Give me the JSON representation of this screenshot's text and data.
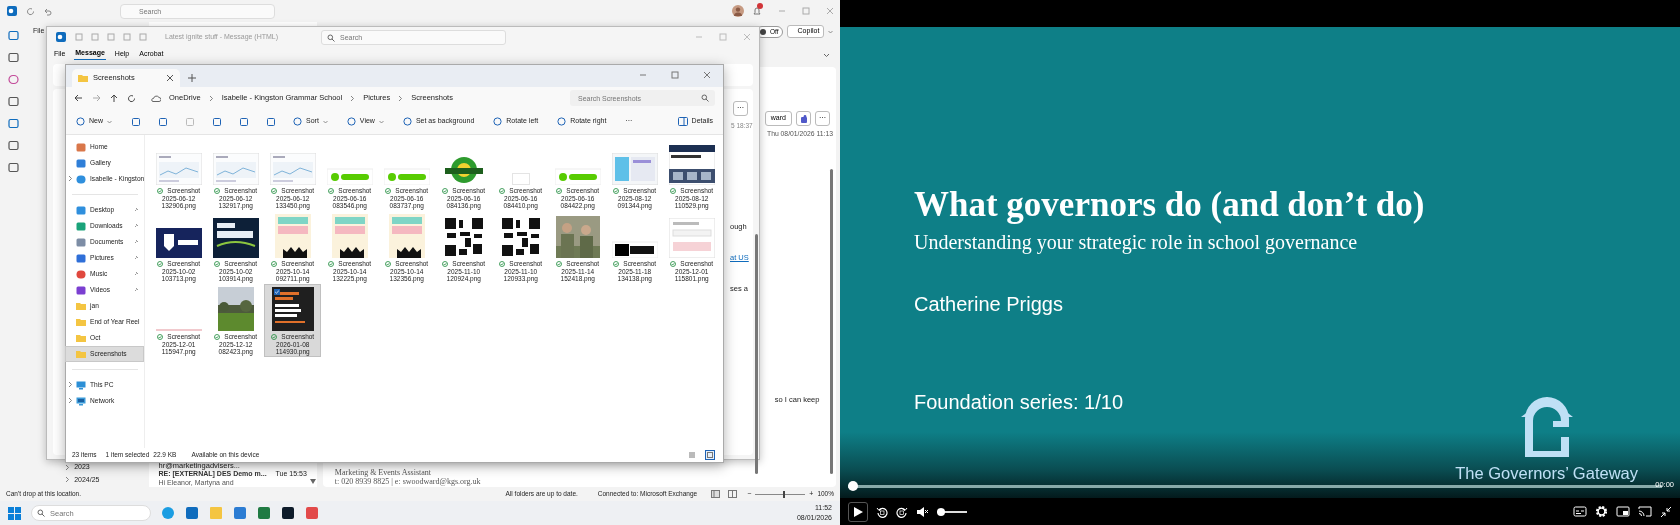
{
  "outlook": {
    "search_placeholder": "Search",
    "menu_file": "File",
    "copilot_toggle": {
      "label": "Off",
      "on": false
    },
    "copilot": "Copilot",
    "folders": [
      "2023",
      "2024/25"
    ],
    "message_list": {
      "sender": "hr@marketingadvisers...",
      "subject": "RE: [EXTERNAL] DES Demo m...",
      "time": "Tue 15:53",
      "preview": "Hi Eleanor, Martyna and"
    },
    "reading": {
      "forward_fragment": "ward",
      "more_label": "···",
      "date": "Thu 08/01/2026 11:13",
      "text_fragment": "so I can keep",
      "signature": [
        "Marketing & Events Assistant",
        "t: 020 8939 8825 | e: swoodward@kgs.org.uk"
      ]
    },
    "status_bar": {
      "message": "Can't drop at this location.",
      "sync": "All folders are up to date.",
      "connection": "Connected to: Microsoft Exchange",
      "zoom_out": "−",
      "zoom_in": "+",
      "zoom": "100%",
      "level": 0.55
    }
  },
  "message_window": {
    "title": "Latest ignite stuff - Message (HTML)",
    "search_placeholder": "Search",
    "tabs": [
      {
        "label": "File",
        "selected": false
      },
      {
        "label": "Message",
        "selected": true
      },
      {
        "label": "Help",
        "selected": false
      },
      {
        "label": "Acrobat",
        "selected": false
      }
    ],
    "more_label": "···",
    "time_fragment": "5 18:37",
    "text_fragments": [
      {
        "text": "ough",
        "link": false
      },
      {
        "text": "at US",
        "link": true
      },
      {
        "text": "ses a",
        "link": false
      }
    ]
  },
  "explorer": {
    "tab": "Screenshots",
    "breadcrumbs": [
      "OneDrive",
      "Isabelle - Kingston Grammar School",
      "Pictures",
      "Screenshots"
    ],
    "search_placeholder": "Search Screenshots",
    "toolbar": [
      {
        "label": "New",
        "dropdown": true
      },
      {
        "label": "Sort",
        "dropdown": true
      },
      {
        "label": "View",
        "dropdown": true
      },
      {
        "label": "Set as background",
        "dropdown": false
      },
      {
        "label": "Rotate left",
        "dropdown": false
      },
      {
        "label": "Rotate right",
        "dropdown": false
      }
    ],
    "more_label": "···",
    "details": "Details",
    "nav_sections": [
      {
        "items": [
          {
            "label": "Home",
            "pinned": false,
            "selected": false,
            "expandable": false
          },
          {
            "label": "Gallery",
            "pinned": false,
            "selected": false,
            "expandable": false
          },
          {
            "label": "Isabelle - Kingston",
            "pinned": false,
            "selected": false,
            "expandable": true
          }
        ]
      },
      {
        "items": [
          {
            "label": "Desktop",
            "pinned": true,
            "selected": false,
            "expandable": false
          },
          {
            "label": "Downloads",
            "pinned": true,
            "selected": false,
            "expandable": false
          },
          {
            "label": "Documents",
            "pinned": true,
            "selected": false,
            "expandable": false
          },
          {
            "label": "Pictures",
            "pinned": true,
            "selected": false,
            "expandable": false
          },
          {
            "label": "Music",
            "pinned": true,
            "selected": false,
            "expandable": false
          },
          {
            "label": "Videos",
            "pinned": true,
            "selected": false,
            "expandable": false
          },
          {
            "label": "jan",
            "pinned": false,
            "selected": false,
            "expandable": false
          },
          {
            "label": "End of Year Reel",
            "pinned": false,
            "selected": false,
            "expandable": false
          },
          {
            "label": "Oct",
            "pinned": false,
            "selected": false,
            "expandable": false
          },
          {
            "label": "Screenshots",
            "pinned": false,
            "selected": true,
            "expandable": false
          }
        ]
      },
      {
        "items": [
          {
            "label": "This PC",
            "pinned": false,
            "selected": false,
            "expandable": true
          },
          {
            "label": "Network",
            "pinned": false,
            "selected": false,
            "expandable": true
          }
        ]
      }
    ],
    "files": [
      {
        "name": [
          "Screenshot",
          "2025-06-12",
          "132906.png"
        ],
        "selected": false
      },
      {
        "name": [
          "Screenshot",
          "2025-06-12",
          "132917.png"
        ],
        "selected": false
      },
      {
        "name": [
          "Screenshot",
          "2025-06-12",
          "133450.png"
        ],
        "selected": false
      },
      {
        "name": [
          "Screenshot",
          "2025-06-16",
          "083546.png"
        ],
        "selected": false
      },
      {
        "name": [
          "Screenshot",
          "2025-06-16",
          "083737.png"
        ],
        "selected": false
      },
      {
        "name": [
          "Screenshot",
          "2025-06-16",
          "084136.png"
        ],
        "selected": false
      },
      {
        "name": [
          "Screenshot",
          "2025-06-16",
          "084410.png"
        ],
        "selected": false
      },
      {
        "name": [
          "Screenshot",
          "2025-06-16",
          "084422.png"
        ],
        "selected": false
      },
      {
        "name": [
          "Screenshot",
          "2025-08-12",
          "091344.png"
        ],
        "selected": false
      },
      {
        "name": [
          "Screenshot",
          "2025-08-12",
          "110529.png"
        ],
        "selected": false
      },
      {
        "name": [
          "Screenshot",
          "2025-10-02",
          "103713.png"
        ],
        "selected": false
      },
      {
        "name": [
          "Screenshot",
          "2025-10-02",
          "103914.png"
        ],
        "selected": false
      },
      {
        "name": [
          "Screenshot",
          "2025-10-14",
          "092711.png"
        ],
        "selected": false
      },
      {
        "name": [
          "Screenshot",
          "2025-10-14",
          "132225.png"
        ],
        "selected": false
      },
      {
        "name": [
          "Screenshot",
          "2025-10-14",
          "132356.png"
        ],
        "selected": false
      },
      {
        "name": [
          "Screenshot",
          "2025-11-10",
          "120924.png"
        ],
        "selected": false
      },
      {
        "name": [
          "Screenshot",
          "2025-11-10",
          "120933.png"
        ],
        "selected": false
      },
      {
        "name": [
          "Screenshot",
          "2025-11-14",
          "152418.png"
        ],
        "selected": false
      },
      {
        "name": [
          "Screenshot",
          "2025-11-18",
          "134138.png"
        ],
        "selected": false
      },
      {
        "name": [
          "Screenshot",
          "2025-12-01",
          "115801.png"
        ],
        "selected": false
      },
      {
        "name": [
          "Screenshot",
          "2025-12-01",
          "115947.png"
        ],
        "selected": false
      },
      {
        "name": [
          "Screenshot",
          "2025-12-12",
          "082423.png"
        ],
        "selected": false
      },
      {
        "name": [
          "Screenshot",
          "2026-01-08",
          "114930.png"
        ],
        "selected": true
      }
    ],
    "status": {
      "count": "23 items",
      "selection": "1 item selected",
      "size": "22.9 KB",
      "availability": "Available on this device"
    }
  },
  "taskbar": {
    "search_placeholder": "Search",
    "time": "11:52",
    "date": "08/01/2026"
  },
  "video": {
    "title": "What governors do (and don’t do)",
    "subtitle": "Understanding your strategic role in school governance",
    "presenter": "Catherine Priggs",
    "series": "Foundation series: 1/10",
    "brand": "The Governors’ Gateway",
    "time": "00:00",
    "progress": {
      "level": 0
    },
    "volume": {
      "level": 0,
      "muted": true
    }
  }
}
